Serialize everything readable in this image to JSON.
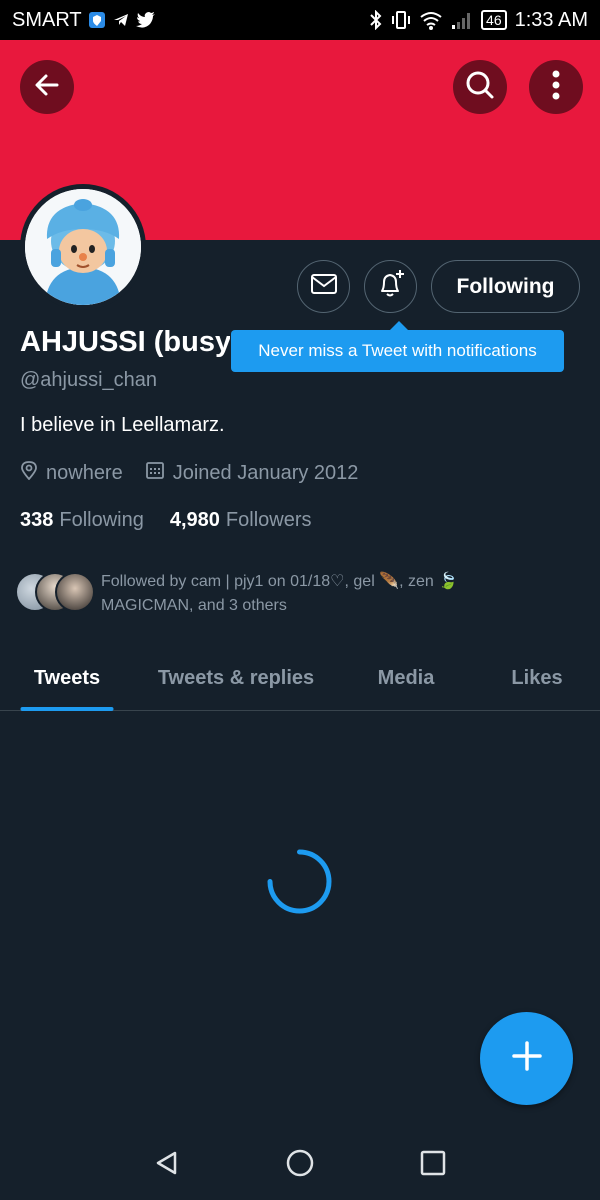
{
  "status_bar": {
    "carrier": "SMART",
    "battery": "46",
    "time": "1:33 AM"
  },
  "profile": {
    "display_name": "AHJUSSI (busy",
    "handle": "@ahjussi_chan",
    "bio": "I believe in Leellamarz.",
    "location": "nowhere",
    "joined": "Joined January 2012",
    "following_count": "338",
    "following_label": "Following",
    "followers_count": "4,980",
    "followers_label": "Followers",
    "followed_by": "Followed by cam | pjy1 on 01/18♡, gel 🪶, zen 🍃 MAGICMAN, and 3 others",
    "following_button": "Following"
  },
  "tooltip": {
    "text": "Never miss a Tweet with notifications"
  },
  "tabs": [
    {
      "label": "Tweets",
      "active": true
    },
    {
      "label": "Tweets & replies",
      "active": false
    },
    {
      "label": "Media",
      "active": false
    },
    {
      "label": "Likes",
      "active": false
    }
  ],
  "colors": {
    "banner": "#e8183d",
    "background": "#15202b",
    "accent": "#1d9bf0"
  },
  "icons": {
    "back": "arrow-left-icon",
    "search": "search-icon",
    "more": "more-vertical-icon",
    "message": "envelope-icon",
    "notify": "bell-plus-icon",
    "location": "location-pin-icon",
    "calendar": "calendar-icon",
    "compose": "plus-icon"
  }
}
